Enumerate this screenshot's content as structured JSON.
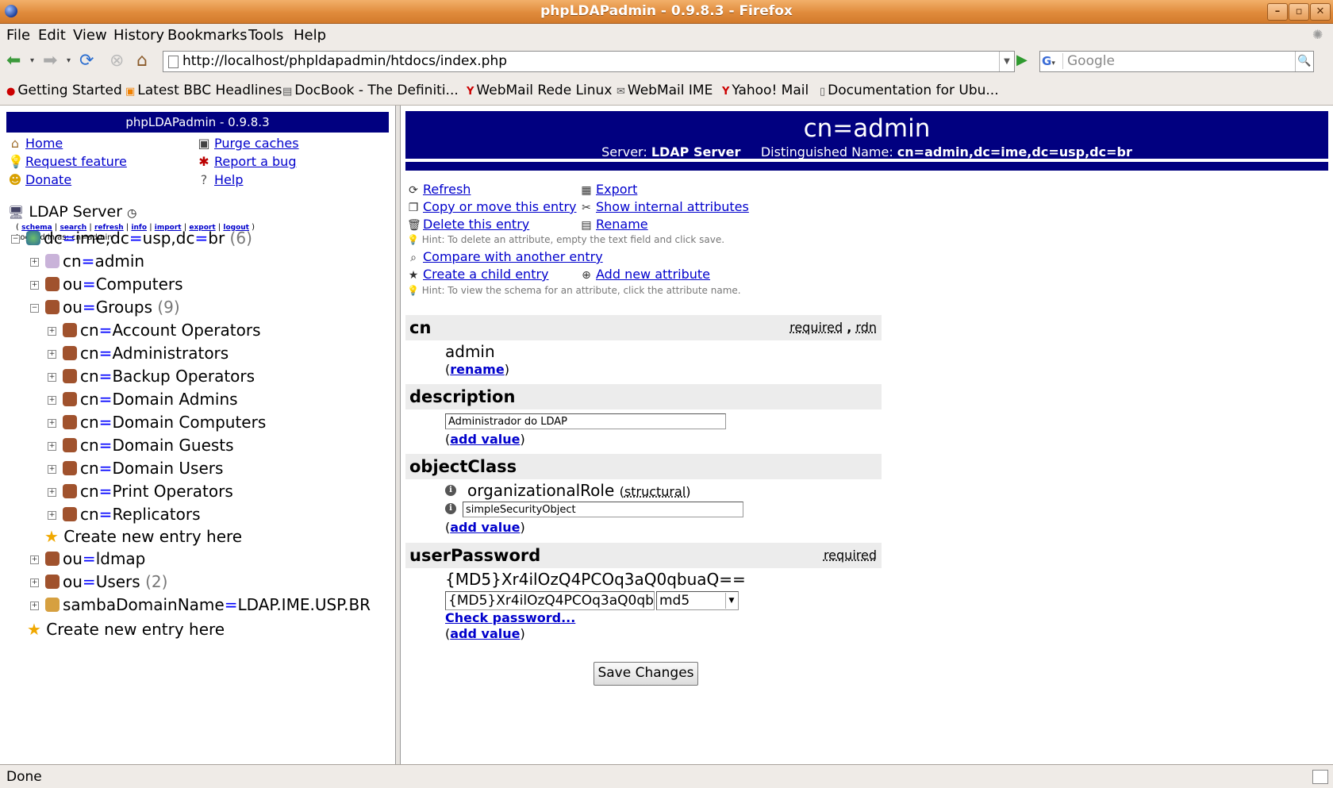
{
  "window": {
    "title": "phpLDAPadmin - 0.9.8.3 - Firefox",
    "buttons": [
      "–",
      "▫",
      "✕"
    ]
  },
  "menu": [
    "File",
    "Edit",
    "View",
    "History",
    "Bookmarks",
    "Tools",
    "Help"
  ],
  "nav": {
    "url": "http://localhost/phpldapadmin/htdocs/index.php",
    "search_placeholder": "Google",
    "search_engine": "G"
  },
  "bookmarks": [
    "Getting Started",
    "Latest BBC Headlines",
    "DocBook - The Definiti...",
    "WebMail Rede Linux",
    "WebMail IME",
    "Yahoo! Mail",
    "Documentation for Ubu..."
  ],
  "left": {
    "header": "phpLDAPadmin - 0.9.8.3",
    "links": {
      "home": "Home",
      "request": "Request feature",
      "donate": "Donate",
      "purge": "Purge caches",
      "bug": "Report a bug",
      "help": "Help"
    },
    "server": "LDAP Server",
    "server_links": [
      "schema",
      "search",
      "refresh",
      "info",
      "import",
      "export",
      "logout"
    ],
    "logged_in": "Logged in as: cn=admin",
    "tree": {
      "root": {
        "a": "dc",
        "b": "ime,",
        "c": "dc",
        "d": "usp,",
        "e": "dc",
        "f": "br",
        "count": "(6)"
      },
      "admin": {
        "k": "cn",
        "v": "admin"
      },
      "computers": {
        "k": "ou",
        "v": "Computers"
      },
      "groups": {
        "k": "ou",
        "v": "Groups",
        "count": "(9)"
      },
      "group_children": [
        {
          "k": "cn",
          "v": "Account Operators"
        },
        {
          "k": "cn",
          "v": "Administrators"
        },
        {
          "k": "cn",
          "v": "Backup Operators"
        },
        {
          "k": "cn",
          "v": "Domain Admins"
        },
        {
          "k": "cn",
          "v": "Domain Computers"
        },
        {
          "k": "cn",
          "v": "Domain Guests"
        },
        {
          "k": "cn",
          "v": "Domain Users"
        },
        {
          "k": "cn",
          "v": "Print Operators"
        },
        {
          "k": "cn",
          "v": "Replicators"
        }
      ],
      "create_in_groups": "Create new entry here",
      "ldmap": {
        "k": "ou",
        "v": "ldmap"
      },
      "users": {
        "k": "ou",
        "v": "Users",
        "count": "(2)"
      },
      "samba": {
        "k": "sambaDomainName",
        "v": "LDAP.IME.USP.BR"
      },
      "create_root": "Create new entry here"
    }
  },
  "right": {
    "title": "cn=admin",
    "server_label": "Server:",
    "server_value": "LDAP Server",
    "dn_label": "Distinguished Name:",
    "dn_value": "cn=admin,dc=ime,dc=usp,dc=br",
    "actions": {
      "refresh": "Refresh",
      "export": "Export",
      "copy": "Copy or move this entry",
      "internal": "Show internal attributes",
      "delete": "Delete this entry",
      "rename": "Rename",
      "hint1": "Hint: To delete an attribute, empty the text field and click save.",
      "compare": "Compare with another entry",
      "child": "Create a child entry",
      "add_attr": "Add new attribute",
      "hint2": "Hint: To view the schema for an attribute, click the attribute name."
    },
    "attrs": {
      "cn": {
        "name": "cn",
        "required": "required",
        "comma": ",",
        "rdn": "rdn",
        "value": "admin",
        "link": "rename"
      },
      "description": {
        "name": "description",
        "value": "Administrador do LDAP",
        "link": "add value"
      },
      "objectClass": {
        "name": "objectClass",
        "structural_value": "organizationalRole",
        "structural_tag": "structural",
        "value2": "simpleSecurityObject",
        "link": "add value"
      },
      "userPassword": {
        "name": "userPassword",
        "required": "required",
        "display": "{MD5}Xr4ilOzQ4PCOq3aQ0qbuaQ==",
        "input": "{MD5}Xr4ilOzQ4PCOq3aQ0qbuaQ==",
        "hash": "md5",
        "check": "Check password...",
        "link": "add value"
      }
    },
    "save": "Save Changes"
  },
  "status": "Done"
}
